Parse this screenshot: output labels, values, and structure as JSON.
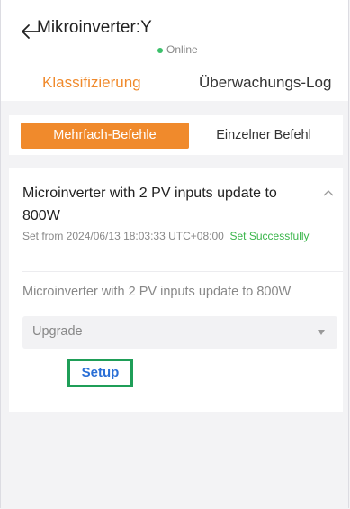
{
  "header": {
    "title": "Mikroinverter:Y",
    "status": "Online",
    "tabs": [
      {
        "label": "Klassifizierung"
      },
      {
        "label": "Überwachungs-Log"
      }
    ]
  },
  "segment": {
    "active": "Mehrfach-Befehle",
    "inactive": "Einzelner Befehl"
  },
  "card": {
    "title": "Microinverter with 2 PV inputs update to 800W",
    "meta_prefix": "Set from 2024/06/13 18:03:33 UTC+08:00",
    "meta_status": "Set Successfully",
    "description": "Microinverter with 2 PV inputs update to 800W",
    "select_value": "Upgrade",
    "setup_label": "Setup"
  },
  "colors": {
    "accent": "#f08a2c",
    "online": "#3cc06b",
    "success": "#39b54a",
    "link": "#2a6fd6",
    "highlight": "#1f9e58"
  }
}
